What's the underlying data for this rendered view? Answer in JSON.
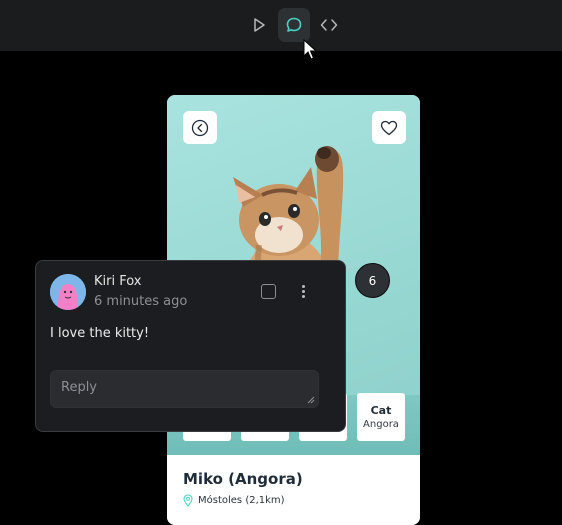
{
  "toolbar": {
    "items": [
      {
        "name": "play",
        "icon": "play-icon"
      },
      {
        "name": "comments",
        "icon": "comment-icon",
        "active": true
      },
      {
        "name": "code",
        "icon": "code-icon"
      }
    ]
  },
  "card": {
    "pet_name": "Miko (Angora)",
    "location": "Móstoles (2,1km)",
    "chip": {
      "title": "Cat",
      "subtitle": "Angora"
    }
  },
  "comment_count": "6",
  "comment": {
    "author": "Kiri Fox",
    "time": "6 minutes ago",
    "message": "I love the kitty!",
    "reply_placeholder": "Reply"
  },
  "colors": {
    "topbar": "#1b1c1e",
    "active_tool": "#2e3134",
    "accent": "#4fd1c5",
    "popover_bg": "#1c1d20",
    "photo_bg": "#a9e3df"
  }
}
